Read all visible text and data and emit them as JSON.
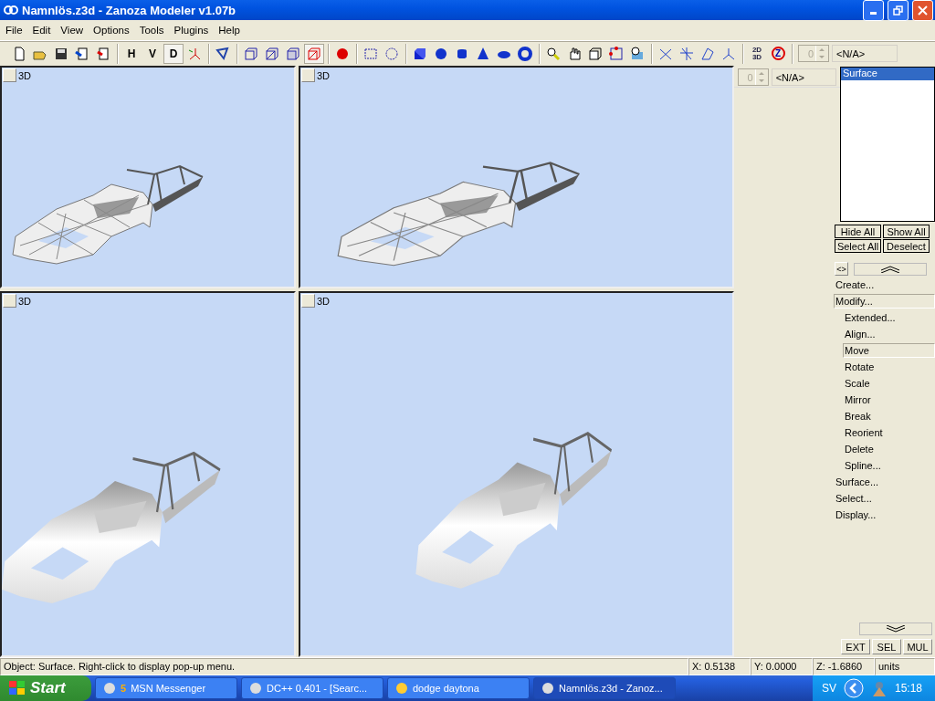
{
  "window": {
    "title": "Namnlös.z3d - Zanoza Modeler v1.07b"
  },
  "menu": [
    "File",
    "Edit",
    "View",
    "Options",
    "Tools",
    "Plugins",
    "Help"
  ],
  "toolbar": [
    [
      {
        "kind": "icon",
        "selected": false
      },
      {
        "kind": "icon",
        "selected": false
      },
      {
        "kind": "icon",
        "selected": false
      },
      {
        "kind": "icon",
        "selected": false
      },
      {
        "kind": "icon",
        "selected": false
      }
    ],
    [
      {
        "kind": "text",
        "label": "H",
        "selected": false
      },
      {
        "kind": "text",
        "label": "V",
        "selected": false
      },
      {
        "kind": "text",
        "label": "D",
        "selected": true
      },
      {
        "kind": "icon",
        "selected": false
      }
    ],
    [
      {
        "kind": "icon",
        "selected": false
      }
    ],
    [
      {
        "kind": "icon",
        "selected": false
      },
      {
        "kind": "icon",
        "selected": false
      },
      {
        "kind": "icon",
        "selected": false
      },
      {
        "kind": "icon",
        "selected": true
      }
    ],
    [
      {
        "kind": "icon",
        "selected": false
      }
    ],
    [
      {
        "kind": "icon",
        "selected": false
      },
      {
        "kind": "icon",
        "selected": false
      }
    ],
    [
      {
        "kind": "icon",
        "selected": false
      },
      {
        "kind": "icon",
        "selected": false
      },
      {
        "kind": "icon",
        "selected": false
      },
      {
        "kind": "icon",
        "selected": false
      },
      {
        "kind": "icon",
        "selected": false
      },
      {
        "kind": "icon",
        "selected": false
      }
    ],
    [
      {
        "kind": "icon",
        "selected": false
      },
      {
        "kind": "icon",
        "selected": false
      },
      {
        "kind": "icon",
        "selected": false
      },
      {
        "kind": "icon",
        "selected": false
      },
      {
        "kind": "icon",
        "selected": false
      }
    ],
    [
      {
        "kind": "icon",
        "selected": false
      },
      {
        "kind": "icon",
        "selected": false
      },
      {
        "kind": "icon",
        "selected": false
      },
      {
        "kind": "icon",
        "selected": false
      }
    ],
    [
      {
        "kind": "stack",
        "lines": [
          "2D",
          "3D"
        ],
        "selected": false
      },
      {
        "kind": "badge",
        "label": "Z",
        "selected": false
      }
    ]
  ],
  "toolbar_spinner": {
    "value": "0",
    "field": "<N/A>"
  },
  "viewports": [
    {
      "label": "3D",
      "kind": "wireframe"
    },
    {
      "label": "3D",
      "kind": "wireframe"
    },
    {
      "label": "3D",
      "kind": "shaded"
    },
    {
      "label": "3D",
      "kind": "shaded"
    }
  ],
  "panel_spinner": {
    "value": "0",
    "field": "<N/A>"
  },
  "object_list": [
    {
      "label": "Surface",
      "selected": true
    }
  ],
  "list_buttons": [
    "Hide All",
    "Show All",
    "Select All",
    "Deselect"
  ],
  "toggle_button": "<>",
  "command_tree": [
    {
      "label": "Create...",
      "selected": false
    },
    {
      "label": "Modify...",
      "selected": true,
      "children": [
        {
          "label": "Extended...",
          "selected": false
        },
        {
          "label": "Align...",
          "selected": false
        },
        {
          "label": "Move",
          "selected": true
        },
        {
          "label": "Rotate",
          "selected": false
        },
        {
          "label": "Scale",
          "selected": false
        },
        {
          "label": "Mirror",
          "selected": false
        },
        {
          "label": "Break",
          "selected": false
        },
        {
          "label": "Reorient",
          "selected": false
        },
        {
          "label": "Delete",
          "selected": false
        },
        {
          "label": "Spline...",
          "selected": false
        }
      ]
    },
    {
      "label": "Surface...",
      "selected": false
    },
    {
      "label": "Select...",
      "selected": false
    },
    {
      "label": "Display...",
      "selected": false
    }
  ],
  "mode_buttons": [
    "EXT",
    "SEL",
    "MUL"
  ],
  "status_bar": {
    "message": "Object: Surface. Right-click to display pop-up menu.",
    "x": "X: 0.5138",
    "y": "Y: 0.0000",
    "z": "Z: -1.6860",
    "units": "units"
  },
  "taskbar": {
    "start": "Start",
    "tasks": [
      {
        "count": "5",
        "label": "MSN Messenger",
        "selected": false
      },
      {
        "label": "DC++ 0.401 - [Searc...",
        "selected": false
      },
      {
        "label": "dodge daytona",
        "selected": false
      },
      {
        "label": "Namnlös.z3d - Zanoz...",
        "selected": true
      }
    ],
    "language": "SV",
    "clock": "15:18"
  }
}
